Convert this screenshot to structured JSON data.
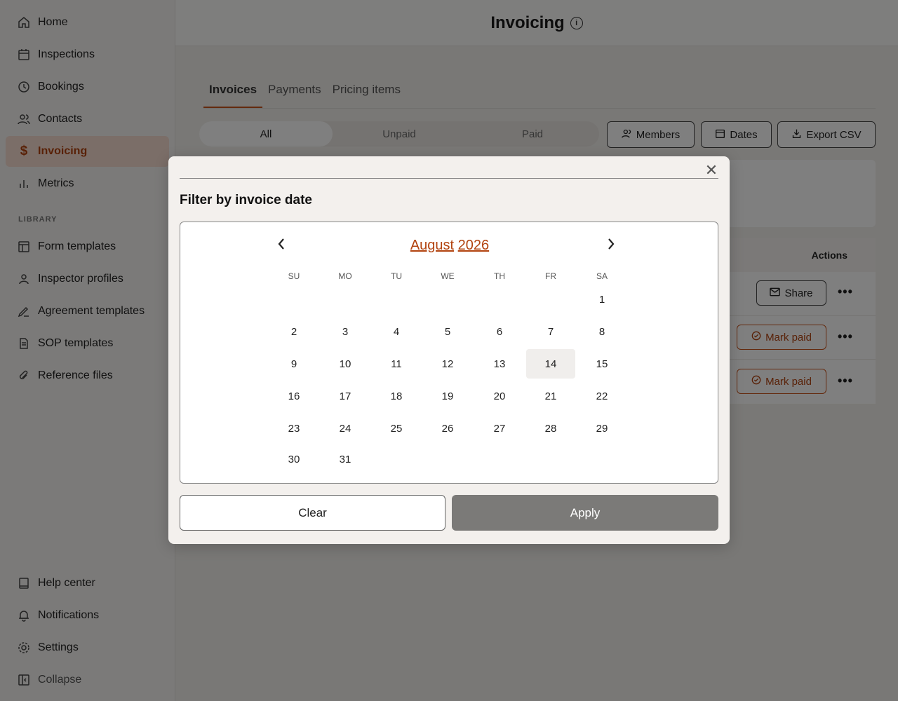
{
  "sidebar": {
    "items": [
      {
        "label": "Home",
        "icon": "home-icon"
      },
      {
        "label": "Inspections",
        "icon": "calendar-icon"
      },
      {
        "label": "Bookings",
        "icon": "clock-icon"
      },
      {
        "label": "Contacts",
        "icon": "users-icon"
      },
      {
        "label": "Invoicing",
        "icon": "dollar-icon",
        "active": true
      },
      {
        "label": "Metrics",
        "icon": "bar-chart-icon"
      }
    ],
    "library_label": "LIBRARY",
    "library_items": [
      {
        "label": "Form templates",
        "icon": "layout-icon"
      },
      {
        "label": "Inspector profiles",
        "icon": "user-icon"
      },
      {
        "label": "Agreement templates",
        "icon": "signature-icon"
      },
      {
        "label": "SOP templates",
        "icon": "document-icon"
      },
      {
        "label": "Reference files",
        "icon": "paperclip-icon"
      }
    ],
    "bottom_items": [
      {
        "label": "Help center",
        "icon": "book-icon"
      },
      {
        "label": "Notifications",
        "icon": "bell-icon"
      },
      {
        "label": "Settings",
        "icon": "gear-icon"
      },
      {
        "label": "Collapse",
        "icon": "sidebar-collapse-icon"
      }
    ]
  },
  "header": {
    "title": "Invoicing",
    "info_icon": "i"
  },
  "tabs": [
    "Invoices",
    "Payments",
    "Pricing items"
  ],
  "filters": [
    "All",
    "Unpaid",
    "Paid"
  ],
  "toolbar": {
    "members": "Members",
    "dates": "Dates",
    "export": "Export CSV"
  },
  "table": {
    "actions_header": "Actions",
    "share_label": "Share",
    "mark_paid_label": "Mark paid",
    "more": "•••"
  },
  "modal": {
    "title": "Filter by invoice date",
    "close": "✕",
    "month": "August",
    "year": "2026",
    "prev": "‹",
    "next": "›",
    "weekdays": [
      "SU",
      "MO",
      "TU",
      "WE",
      "TH",
      "FR",
      "SA"
    ],
    "days": [
      "1",
      "2",
      "3",
      "4",
      "5",
      "6",
      "7",
      "8",
      "9",
      "10",
      "11",
      "12",
      "13",
      "14",
      "15",
      "16",
      "17",
      "18",
      "19",
      "20",
      "21",
      "22",
      "23",
      "24",
      "25",
      "26",
      "27",
      "28",
      "29",
      "30",
      "31"
    ],
    "first_weekday": 6,
    "highlighted_day": "14",
    "clear_label": "Clear",
    "apply_label": "Apply"
  },
  "colors": {
    "accent": "#c9541d",
    "accent_text": "#b2430f",
    "apply_bg": "#7b7a78"
  }
}
